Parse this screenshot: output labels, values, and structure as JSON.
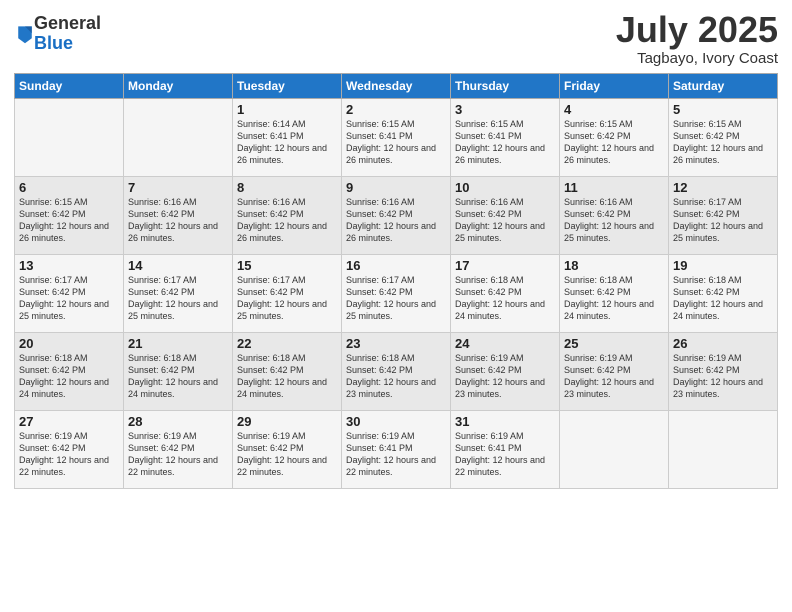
{
  "logo": {
    "general": "General",
    "blue": "Blue"
  },
  "title": "July 2025",
  "location": "Tagbayo, Ivory Coast",
  "days_of_week": [
    "Sunday",
    "Monday",
    "Tuesday",
    "Wednesday",
    "Thursday",
    "Friday",
    "Saturday"
  ],
  "weeks": [
    [
      {
        "day": "",
        "info": ""
      },
      {
        "day": "",
        "info": ""
      },
      {
        "day": "1",
        "info": "Sunrise: 6:14 AM\nSunset: 6:41 PM\nDaylight: 12 hours and 26 minutes."
      },
      {
        "day": "2",
        "info": "Sunrise: 6:15 AM\nSunset: 6:41 PM\nDaylight: 12 hours and 26 minutes."
      },
      {
        "day": "3",
        "info": "Sunrise: 6:15 AM\nSunset: 6:41 PM\nDaylight: 12 hours and 26 minutes."
      },
      {
        "day": "4",
        "info": "Sunrise: 6:15 AM\nSunset: 6:42 PM\nDaylight: 12 hours and 26 minutes."
      },
      {
        "day": "5",
        "info": "Sunrise: 6:15 AM\nSunset: 6:42 PM\nDaylight: 12 hours and 26 minutes."
      }
    ],
    [
      {
        "day": "6",
        "info": "Sunrise: 6:15 AM\nSunset: 6:42 PM\nDaylight: 12 hours and 26 minutes."
      },
      {
        "day": "7",
        "info": "Sunrise: 6:16 AM\nSunset: 6:42 PM\nDaylight: 12 hours and 26 minutes."
      },
      {
        "day": "8",
        "info": "Sunrise: 6:16 AM\nSunset: 6:42 PM\nDaylight: 12 hours and 26 minutes."
      },
      {
        "day": "9",
        "info": "Sunrise: 6:16 AM\nSunset: 6:42 PM\nDaylight: 12 hours and 26 minutes."
      },
      {
        "day": "10",
        "info": "Sunrise: 6:16 AM\nSunset: 6:42 PM\nDaylight: 12 hours and 25 minutes."
      },
      {
        "day": "11",
        "info": "Sunrise: 6:16 AM\nSunset: 6:42 PM\nDaylight: 12 hours and 25 minutes."
      },
      {
        "day": "12",
        "info": "Sunrise: 6:17 AM\nSunset: 6:42 PM\nDaylight: 12 hours and 25 minutes."
      }
    ],
    [
      {
        "day": "13",
        "info": "Sunrise: 6:17 AM\nSunset: 6:42 PM\nDaylight: 12 hours and 25 minutes."
      },
      {
        "day": "14",
        "info": "Sunrise: 6:17 AM\nSunset: 6:42 PM\nDaylight: 12 hours and 25 minutes."
      },
      {
        "day": "15",
        "info": "Sunrise: 6:17 AM\nSunset: 6:42 PM\nDaylight: 12 hours and 25 minutes."
      },
      {
        "day": "16",
        "info": "Sunrise: 6:17 AM\nSunset: 6:42 PM\nDaylight: 12 hours and 25 minutes."
      },
      {
        "day": "17",
        "info": "Sunrise: 6:18 AM\nSunset: 6:42 PM\nDaylight: 12 hours and 24 minutes."
      },
      {
        "day": "18",
        "info": "Sunrise: 6:18 AM\nSunset: 6:42 PM\nDaylight: 12 hours and 24 minutes."
      },
      {
        "day": "19",
        "info": "Sunrise: 6:18 AM\nSunset: 6:42 PM\nDaylight: 12 hours and 24 minutes."
      }
    ],
    [
      {
        "day": "20",
        "info": "Sunrise: 6:18 AM\nSunset: 6:42 PM\nDaylight: 12 hours and 24 minutes."
      },
      {
        "day": "21",
        "info": "Sunrise: 6:18 AM\nSunset: 6:42 PM\nDaylight: 12 hours and 24 minutes."
      },
      {
        "day": "22",
        "info": "Sunrise: 6:18 AM\nSunset: 6:42 PM\nDaylight: 12 hours and 24 minutes."
      },
      {
        "day": "23",
        "info": "Sunrise: 6:18 AM\nSunset: 6:42 PM\nDaylight: 12 hours and 23 minutes."
      },
      {
        "day": "24",
        "info": "Sunrise: 6:19 AM\nSunset: 6:42 PM\nDaylight: 12 hours and 23 minutes."
      },
      {
        "day": "25",
        "info": "Sunrise: 6:19 AM\nSunset: 6:42 PM\nDaylight: 12 hours and 23 minutes."
      },
      {
        "day": "26",
        "info": "Sunrise: 6:19 AM\nSunset: 6:42 PM\nDaylight: 12 hours and 23 minutes."
      }
    ],
    [
      {
        "day": "27",
        "info": "Sunrise: 6:19 AM\nSunset: 6:42 PM\nDaylight: 12 hours and 22 minutes."
      },
      {
        "day": "28",
        "info": "Sunrise: 6:19 AM\nSunset: 6:42 PM\nDaylight: 12 hours and 22 minutes."
      },
      {
        "day": "29",
        "info": "Sunrise: 6:19 AM\nSunset: 6:42 PM\nDaylight: 12 hours and 22 minutes."
      },
      {
        "day": "30",
        "info": "Sunrise: 6:19 AM\nSunset: 6:41 PM\nDaylight: 12 hours and 22 minutes."
      },
      {
        "day": "31",
        "info": "Sunrise: 6:19 AM\nSunset: 6:41 PM\nDaylight: 12 hours and 22 minutes."
      },
      {
        "day": "",
        "info": ""
      },
      {
        "day": "",
        "info": ""
      }
    ]
  ]
}
